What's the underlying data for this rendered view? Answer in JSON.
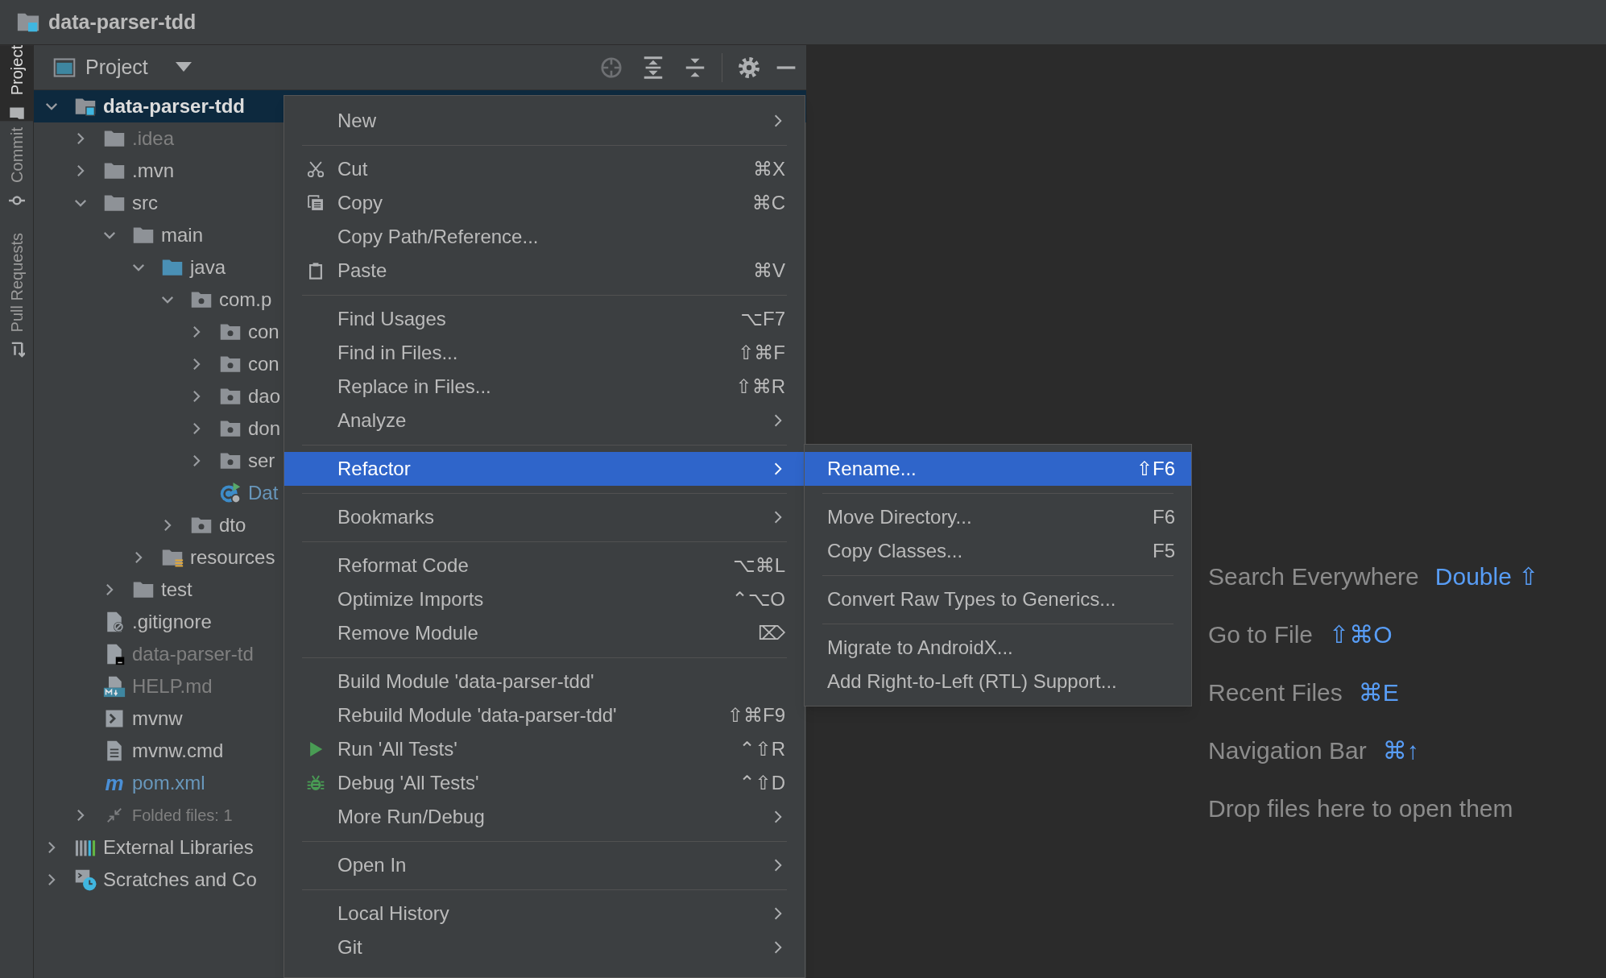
{
  "window": {
    "title": "data-parser-tdd"
  },
  "tool_tabs": [
    {
      "label": "Project",
      "selected": true,
      "kind": "project"
    },
    {
      "label": "Commit",
      "selected": false,
      "kind": "commit"
    },
    {
      "label": "Pull Requests",
      "selected": false,
      "kind": "pull-requests"
    }
  ],
  "project_panel": {
    "view": "Project",
    "tree": [
      {
        "label": "data-parser-tdd",
        "kind": "module",
        "expanded": true,
        "selected": true,
        "children": [
          {
            "label": ".idea",
            "kind": "folder",
            "expanded": false,
            "selected": false,
            "color": "#808080"
          },
          {
            "label": ".mvn",
            "kind": "folder",
            "expanded": false,
            "selected": false
          },
          {
            "label": "src",
            "kind": "folder",
            "expanded": true,
            "selected": false,
            "children": [
              {
                "label": "main",
                "kind": "folder",
                "expanded": true,
                "selected": false,
                "children": [
                  {
                    "label": "java",
                    "kind": "source",
                    "expanded": true,
                    "selected": false,
                    "children": [
                      {
                        "label": "com.p",
                        "kind": "package",
                        "expanded": true,
                        "selected": false,
                        "children": [
                          {
                            "label": "con",
                            "kind": "package",
                            "expanded": false,
                            "selected": false
                          },
                          {
                            "label": "con",
                            "kind": "package",
                            "expanded": false,
                            "selected": false
                          },
                          {
                            "label": "dao",
                            "kind": "package",
                            "expanded": false,
                            "selected": false
                          },
                          {
                            "label": "don",
                            "kind": "package",
                            "expanded": false,
                            "selected": false
                          },
                          {
                            "label": "ser",
                            "kind": "package",
                            "expanded": false,
                            "selected": false
                          },
                          {
                            "label": "Dat",
                            "kind": "class",
                            "selected": false,
                            "color": "#6897bb"
                          }
                        ]
                      },
                      {
                        "label": "dto",
                        "kind": "package",
                        "expanded": false,
                        "selected": false
                      }
                    ]
                  },
                  {
                    "label": "resources",
                    "kind": "resources",
                    "expanded": false,
                    "selected": false
                  }
                ]
              },
              {
                "label": "test",
                "kind": "folder",
                "expanded": false,
                "selected": false
              }
            ]
          },
          {
            "label": ".gitignore",
            "kind": "gitignore",
            "selected": false
          },
          {
            "label": "data-parser-td",
            "kind": "file-dark",
            "selected": false,
            "color": "#808080"
          },
          {
            "label": "HELP.md",
            "kind": "markdown",
            "selected": false,
            "color": "#808080"
          },
          {
            "label": "mvnw",
            "kind": "shell",
            "selected": false
          },
          {
            "label": "mvnw.cmd",
            "kind": "text",
            "selected": false
          },
          {
            "label": "pom.xml",
            "kind": "glyph",
            "glyph": "m",
            "selected": false,
            "color": "#6897bb"
          },
          {
            "label": "Folded files: 1",
            "kind": "folded",
            "expanded": false,
            "selected": false
          }
        ]
      },
      {
        "label": "External Libraries",
        "kind": "libraries",
        "expanded": false,
        "selected": false
      },
      {
        "label": "Scratches and Co",
        "kind": "scratches",
        "expanded": false,
        "selected": false
      }
    ]
  },
  "context_menu": {
    "items": [
      {
        "kind": "item",
        "label": "New",
        "submenu": true,
        "selected": false
      },
      {
        "kind": "separator"
      },
      {
        "kind": "cut",
        "label": "Cut",
        "shortcut": "⌘X",
        "selected": false
      },
      {
        "kind": "copy",
        "label": "Copy",
        "shortcut": "⌘C",
        "selected": false
      },
      {
        "kind": "item",
        "label": "Copy Path/Reference...",
        "selected": false
      },
      {
        "kind": "paste",
        "label": "Paste",
        "shortcut": "⌘V",
        "selected": false
      },
      {
        "kind": "separator"
      },
      {
        "kind": "item",
        "label": "Find Usages",
        "shortcut": "⌥F7",
        "selected": false
      },
      {
        "kind": "item",
        "label": "Find in Files...",
        "shortcut": "⇧⌘F",
        "selected": false
      },
      {
        "kind": "item",
        "label": "Replace in Files...",
        "shortcut": "⇧⌘R",
        "selected": false
      },
      {
        "kind": "item",
        "label": "Analyze",
        "submenu": true,
        "selected": false
      },
      {
        "kind": "separator"
      },
      {
        "kind": "item",
        "label": "Refactor",
        "submenu": true,
        "selected": true
      },
      {
        "kind": "separator"
      },
      {
        "kind": "item",
        "label": "Bookmarks",
        "submenu": true,
        "selected": false
      },
      {
        "kind": "separator"
      },
      {
        "kind": "item",
        "label": "Reformat Code",
        "shortcut": "⌥⌘L",
        "selected": false
      },
      {
        "kind": "item",
        "label": "Optimize Imports",
        "shortcut": "⌃⌥O",
        "selected": false
      },
      {
        "kind": "item",
        "label": "Remove Module",
        "shortcut": "⌦",
        "selected": false
      },
      {
        "kind": "separator"
      },
      {
        "kind": "item",
        "label": "Build Module 'data-parser-tdd'",
        "selected": false
      },
      {
        "kind": "item",
        "label": "Rebuild Module 'data-parser-tdd'",
        "shortcut": "⇧⌘F9",
        "selected": false
      },
      {
        "kind": "run",
        "label": "Run 'All Tests'",
        "shortcut": "⌃⇧R",
        "selected": false
      },
      {
        "kind": "debug",
        "label": "Debug 'All Tests'",
        "shortcut": "⌃⇧D",
        "selected": false
      },
      {
        "kind": "item",
        "label": "More Run/Debug",
        "submenu": true,
        "selected": false
      },
      {
        "kind": "separator"
      },
      {
        "kind": "item",
        "label": "Open In",
        "submenu": true,
        "selected": false
      },
      {
        "kind": "separator"
      },
      {
        "kind": "item",
        "label": "Local History",
        "submenu": true,
        "selected": false
      },
      {
        "kind": "item",
        "label": "Git",
        "submenu": true,
        "selected": false
      }
    ]
  },
  "submenu": {
    "items": [
      {
        "kind": "item",
        "label": "Rename...",
        "shortcut": "⇧F6",
        "selected": true
      },
      {
        "kind": "separator"
      },
      {
        "kind": "item",
        "label": "Move Directory...",
        "shortcut": "F6",
        "selected": false
      },
      {
        "kind": "item",
        "label": "Copy Classes...",
        "shortcut": "F5",
        "selected": false
      },
      {
        "kind": "separator"
      },
      {
        "kind": "item",
        "label": "Convert Raw Types to Generics...",
        "selected": false
      },
      {
        "kind": "separator"
      },
      {
        "kind": "item",
        "label": "Migrate to AndroidX...",
        "selected": false
      },
      {
        "kind": "item",
        "label": "Add Right-to-Left (RTL) Support...",
        "selected": false
      }
    ]
  },
  "editor_hints": [
    {
      "label": "Search Everywhere",
      "shortcut": "Double ⇧"
    },
    {
      "label": "Go to File",
      "shortcut": "⇧⌘O"
    },
    {
      "label": "Recent Files",
      "shortcut": "⌘E"
    },
    {
      "label": "Navigation Bar",
      "shortcut": "⌘↑"
    },
    {
      "label": "Drop files here to open them"
    }
  ]
}
